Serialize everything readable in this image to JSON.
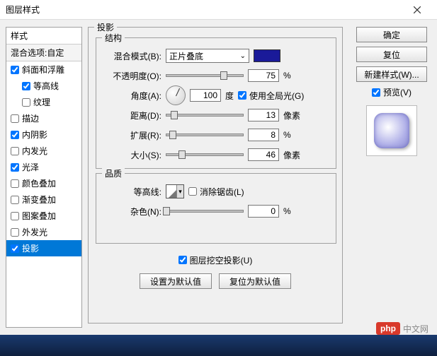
{
  "window": {
    "title": "图层样式",
    "close": "×"
  },
  "sidebar": {
    "heading": "样式",
    "subheading": "混合选项:自定",
    "items": [
      {
        "label": "斜面和浮雕",
        "checked": true,
        "indent": false
      },
      {
        "label": "等高线",
        "checked": true,
        "indent": true
      },
      {
        "label": "纹理",
        "checked": false,
        "indent": true
      },
      {
        "label": "描边",
        "checked": false,
        "indent": false
      },
      {
        "label": "内阴影",
        "checked": true,
        "indent": false
      },
      {
        "label": "内发光",
        "checked": false,
        "indent": false
      },
      {
        "label": "光泽",
        "checked": true,
        "indent": false
      },
      {
        "label": "颜色叠加",
        "checked": false,
        "indent": false
      },
      {
        "label": "渐变叠加",
        "checked": false,
        "indent": false
      },
      {
        "label": "图案叠加",
        "checked": false,
        "indent": false
      },
      {
        "label": "外发光",
        "checked": false,
        "indent": false
      },
      {
        "label": "投影",
        "checked": true,
        "indent": false,
        "active": true
      }
    ]
  },
  "panel": {
    "main_title": "投影",
    "structure": {
      "title": "结构",
      "blend_label": "混合模式(B):",
      "blend_value": "正片叠底",
      "color": "#1a1a99",
      "opacity_label": "不透明度(O):",
      "opacity_value": "75",
      "opacity_unit": "%",
      "angle_label": "角度(A):",
      "angle_value": "100",
      "angle_unit": "度",
      "global_light_label": "使用全局光(G)",
      "global_light_checked": true,
      "distance_label": "距离(D):",
      "distance_value": "13",
      "distance_unit": "像素",
      "spread_label": "扩展(R):",
      "spread_value": "8",
      "spread_unit": "%",
      "size_label": "大小(S):",
      "size_value": "46",
      "size_unit": "像素"
    },
    "quality": {
      "title": "品质",
      "contour_label": "等高线:",
      "antialias_label": "消除锯齿(L)",
      "antialias_checked": false,
      "noise_label": "杂色(N):",
      "noise_value": "0",
      "noise_unit": "%"
    },
    "knockout_label": "图层挖空投影(U)",
    "knockout_checked": true,
    "btn_default": "设置为默认值",
    "btn_reset": "复位为默认值"
  },
  "right": {
    "ok": "确定",
    "reset": "复位",
    "new_style": "新建样式(W)...",
    "preview_label": "预览(V)",
    "preview_checked": true
  },
  "watermark": {
    "logo": "php",
    "text": "中文网"
  }
}
